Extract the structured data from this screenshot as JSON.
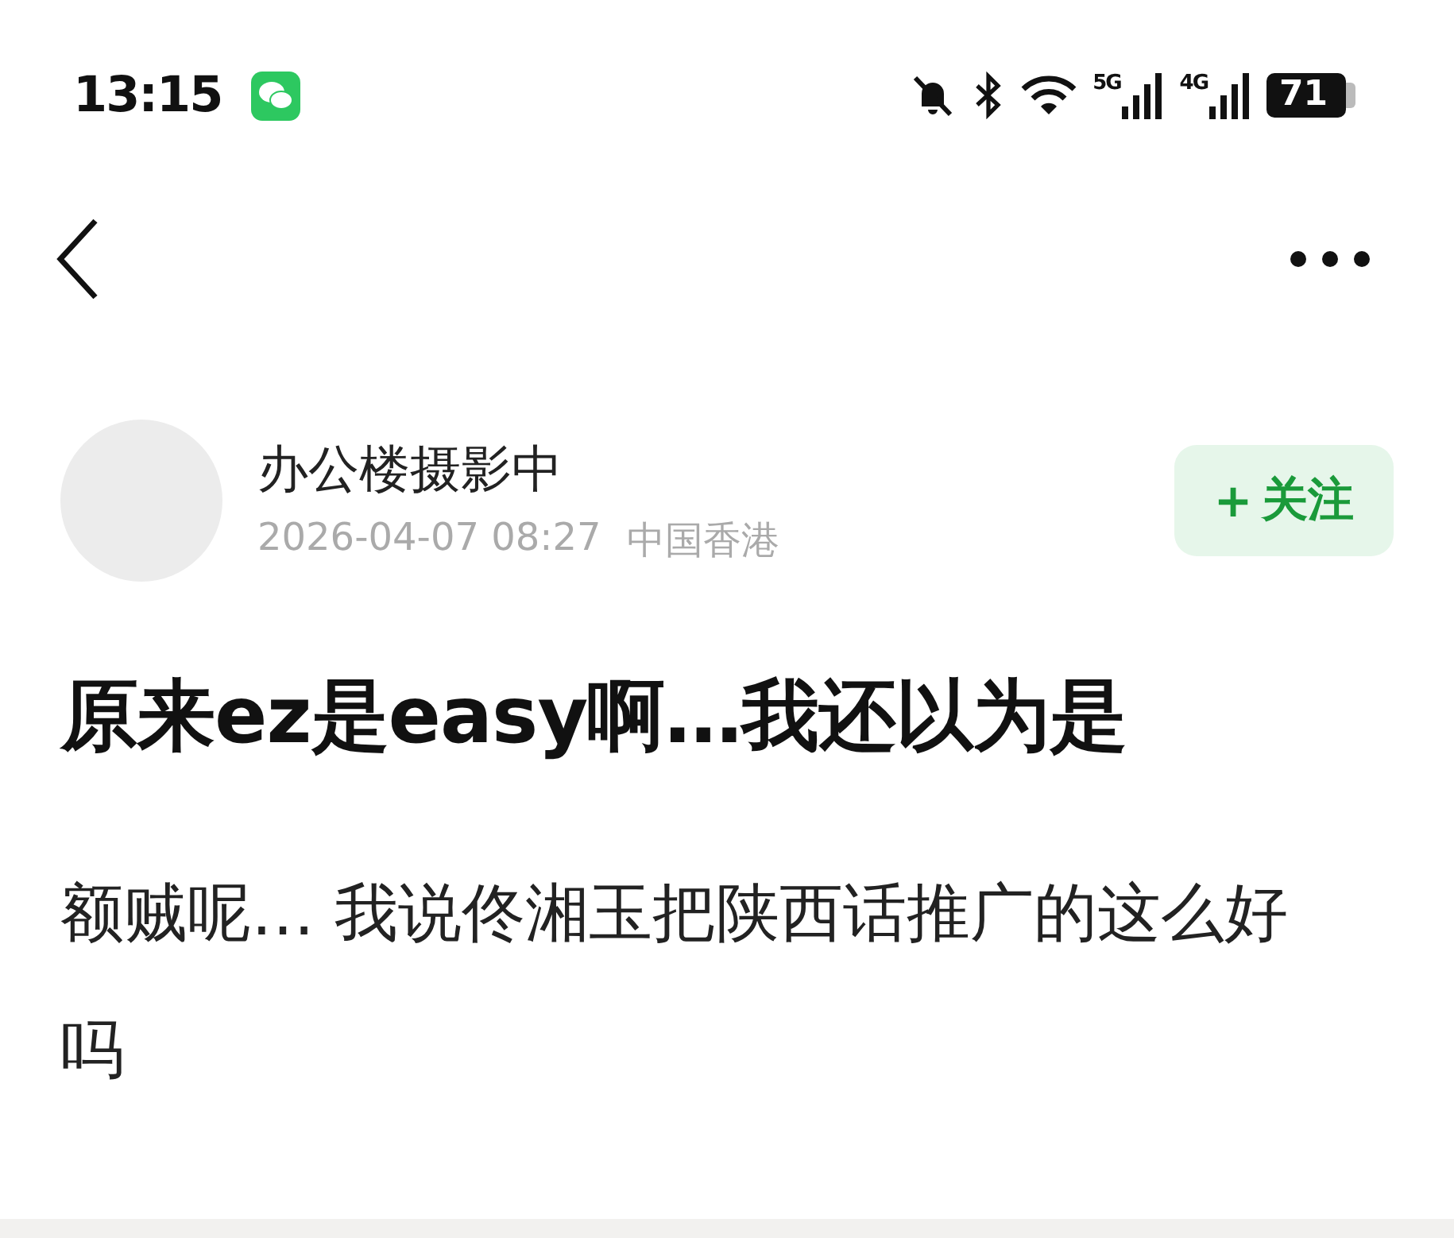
{
  "status_bar": {
    "time": "13:15",
    "network_1": "5G",
    "network_2": "4G",
    "battery": "71"
  },
  "post": {
    "author": "办公楼摄影中",
    "date": "2026-04-07 08:27",
    "location": "中国香港",
    "follow_button": {
      "icon": "+",
      "label": "关注"
    },
    "title": "原来ez是easy啊…我还以为是",
    "body": "额贼呢… 我说佟湘玉把陕西话推广的这么好吗"
  }
}
